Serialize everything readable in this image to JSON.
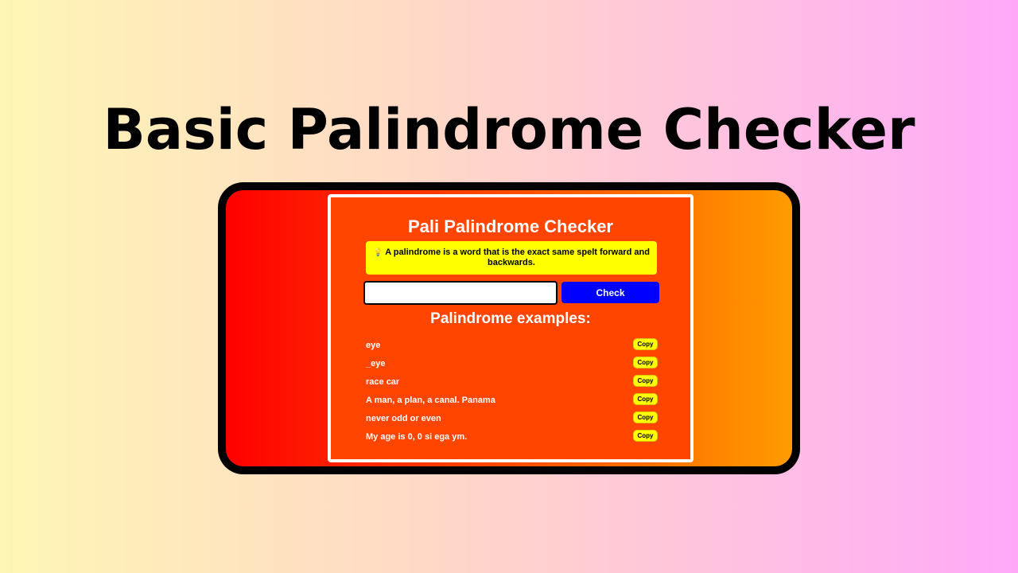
{
  "headline": "Basic Palindrome Checker",
  "app": {
    "title": "Pali Palindrome Checker",
    "info_icon": "lightbulb-icon",
    "info_text": "A palindrome is a word that is the exact same spelt forward and backwards.",
    "input": {
      "value": "",
      "placeholder": ""
    },
    "check_label": "Check",
    "examples_title": "Palindrome examples:",
    "copy_label": "Copy",
    "examples": [
      "eye",
      "_eye",
      "race car",
      "A man, a plan, a canal. Panama",
      "never odd or even",
      "My age is 0, 0 si ega ym."
    ]
  },
  "colors": {
    "panel": "#ff4500",
    "info_bg": "#ffff00",
    "check_button": "#0000ff",
    "copy_button": "#ffff00"
  }
}
